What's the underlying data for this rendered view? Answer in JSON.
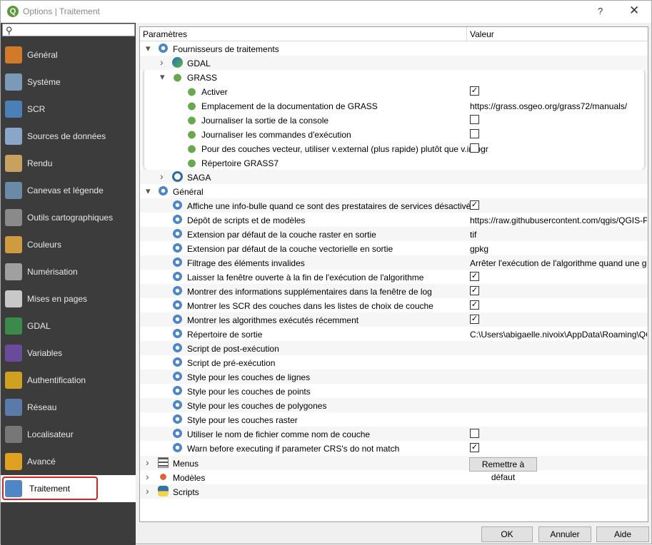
{
  "window": {
    "title": "Options | Traitement",
    "help": "?",
    "close": "✕"
  },
  "sidebar": {
    "items": [
      {
        "label": "Général",
        "icon": "tools-icon",
        "color": "#d07a2a"
      },
      {
        "label": "Système",
        "icon": "system-gear-icon",
        "color": "#7a9ab8"
      },
      {
        "label": "SCR",
        "icon": "globe-grid-icon",
        "color": "#4a7fb8"
      },
      {
        "label": "Sources de données",
        "icon": "table-icon",
        "color": "#8aa6c8"
      },
      {
        "label": "Rendu",
        "icon": "paintbrush-icon",
        "color": "#c8a060"
      },
      {
        "label": "Canevas et légende",
        "icon": "map-canvas-icon",
        "color": "#6a8aa8"
      },
      {
        "label": "Outils cartographiques",
        "icon": "map-tools-icon",
        "color": "#8a8a8a"
      },
      {
        "label": "Couleurs",
        "icon": "palette-brush-icon",
        "color": "#d09a40"
      },
      {
        "label": "Numérisation",
        "icon": "digitize-icon",
        "color": "#a0a0a0"
      },
      {
        "label": "Mises en pages",
        "icon": "layout-icon",
        "color": "#c8c8c8"
      },
      {
        "label": "GDAL",
        "icon": "gdal-globe-icon",
        "color": "#3a8a4a"
      },
      {
        "label": "Variables",
        "icon": "epsilon-icon",
        "color": "#6a4a9a"
      },
      {
        "label": "Authentification",
        "icon": "lock-icon",
        "color": "#d0a020"
      },
      {
        "label": "Réseau",
        "icon": "network-icon",
        "color": "#5a7aaa"
      },
      {
        "label": "Localisateur",
        "icon": "magnifier-icon",
        "color": "#777777"
      },
      {
        "label": "Avancé",
        "icon": "warning-icon",
        "color": "#e0a020"
      },
      {
        "label": "Traitement",
        "icon": "processing-gear-icon",
        "color": "#4f86c6"
      }
    ],
    "active_index": 16
  },
  "tree": {
    "header": {
      "param": "Paramètres",
      "value": "Valeur"
    },
    "rows": [
      {
        "label": "Fournisseurs de traitements",
        "depth": 0,
        "arrow": "down",
        "icon": "gear-icon"
      },
      {
        "label": "GDAL",
        "depth": 1,
        "arrow": "right",
        "icon": "gdal-icon"
      },
      {
        "label": "GRASS",
        "depth": 1,
        "arrow": "down",
        "icon": "grass-icon"
      },
      {
        "label": "Activer",
        "depth": 2,
        "icon": "grass-icon",
        "check": true
      },
      {
        "label": "Emplacement de la documentation de GRASS",
        "depth": 2,
        "icon": "grass-icon",
        "value": "https://grass.osgeo.org/grass72/manuals/"
      },
      {
        "label": "Journaliser la sortie de la console",
        "depth": 2,
        "icon": "grass-icon",
        "check": false
      },
      {
        "label": "Journaliser les commandes d'exécution",
        "depth": 2,
        "icon": "grass-icon",
        "check": false
      },
      {
        "label": "Pour des couches vecteur, utiliser v.external (plus rapide) plutôt que v.in.ogr",
        "depth": 2,
        "icon": "grass-icon",
        "check": false
      },
      {
        "label": "Répertoire GRASS7",
        "depth": 2,
        "icon": "grass-icon"
      },
      {
        "label": "SAGA",
        "depth": 1,
        "arrow": "right",
        "icon": "saga-icon"
      },
      {
        "label": "Général",
        "depth": 0,
        "arrow": "down",
        "icon": "gear-icon"
      },
      {
        "label": "Affiche une info-bulle quand ce sont des prestataires de services désactivés",
        "depth": 1,
        "icon": "gear-icon",
        "check": true
      },
      {
        "label": "Dépôt de scripts et de modèles",
        "depth": 1,
        "icon": "gear-icon",
        "value": "https://raw.githubusercontent.com/qgis/QGIS-Pr..."
      },
      {
        "label": "Extension par défaut de la couche raster en sortie",
        "depth": 1,
        "icon": "gear-icon",
        "value": "tif"
      },
      {
        "label": "Extension par défaut de la couche vectorielle en sortie",
        "depth": 1,
        "icon": "gear-icon",
        "value": "gpkg"
      },
      {
        "label": "Filtrage des éléments invalides",
        "depth": 1,
        "icon": "gear-icon",
        "value": "Arrêter l'exécution de l'algorithme quand une géo..."
      },
      {
        "label": "Laisser la fenêtre ouverte à la fin de l'exécution de l'algorithme",
        "depth": 1,
        "icon": "gear-icon",
        "check": true
      },
      {
        "label": "Montrer des informations supplémentaires dans la fenêtre de log",
        "depth": 1,
        "icon": "gear-icon",
        "check": true
      },
      {
        "label": "Montrer les SCR des couches dans les listes de choix de couche",
        "depth": 1,
        "icon": "gear-icon",
        "check": true
      },
      {
        "label": "Montrer les algorithmes exécutés récemment",
        "depth": 1,
        "icon": "gear-icon",
        "check": true
      },
      {
        "label": "Répertoire de sortie",
        "depth": 1,
        "icon": "gear-icon",
        "value": "C:\\Users\\abigaelle.nivoix\\AppData\\Roaming\\QGI..."
      },
      {
        "label": "Script de post-exécution",
        "depth": 1,
        "icon": "gear-icon"
      },
      {
        "label": "Script de pré-exécution",
        "depth": 1,
        "icon": "gear-icon"
      },
      {
        "label": "Style pour les couches de lignes",
        "depth": 1,
        "icon": "gear-icon"
      },
      {
        "label": "Style pour les couches de points",
        "depth": 1,
        "icon": "gear-icon"
      },
      {
        "label": "Style pour les couches de polygones",
        "depth": 1,
        "icon": "gear-icon"
      },
      {
        "label": "Style pour les couches raster",
        "depth": 1,
        "icon": "gear-icon"
      },
      {
        "label": "Utiliser le nom de fichier comme nom de couche",
        "depth": 1,
        "icon": "gear-icon",
        "check": false
      },
      {
        "label": "Warn before executing if parameter CRS's do not match",
        "depth": 1,
        "icon": "gear-icon",
        "check": true
      },
      {
        "label": "Menus",
        "depth": 0,
        "arrow": "right",
        "icon": "menu-icon",
        "button": "Remettre à défaut"
      },
      {
        "label": "Modèles",
        "depth": 0,
        "arrow": "right",
        "icon": "models-icon"
      },
      {
        "label": "Scripts",
        "depth": 0,
        "arrow": "right",
        "icon": "scripts-icon"
      }
    ]
  },
  "buttons": {
    "ok": "OK",
    "cancel": "Annuler",
    "help": "Aide"
  }
}
